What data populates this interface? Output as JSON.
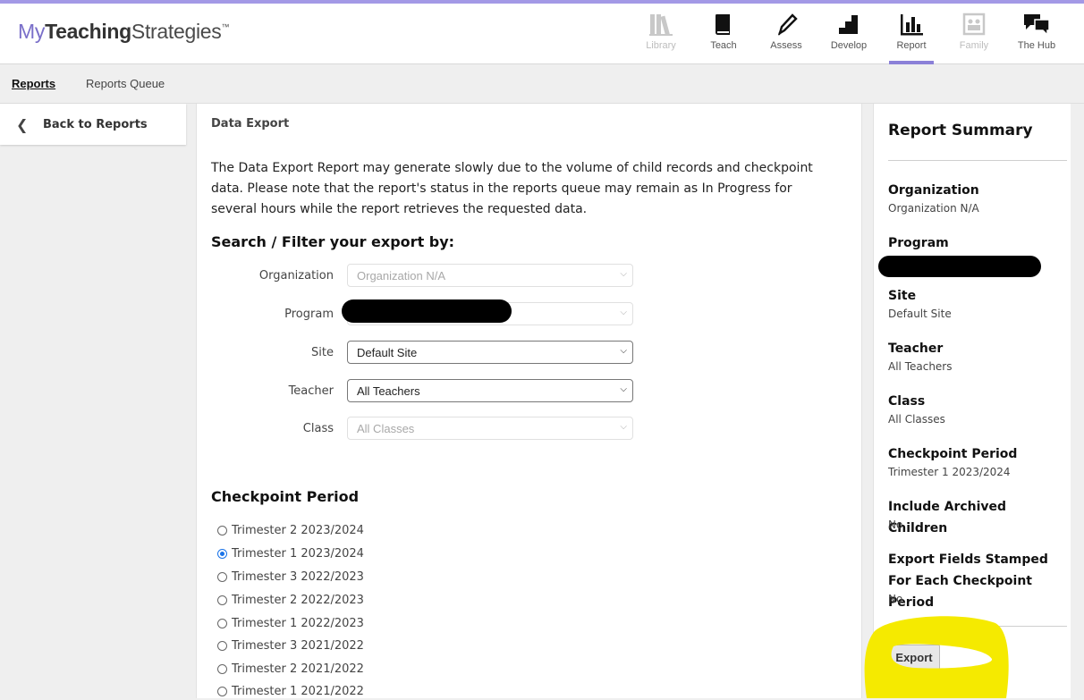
{
  "logo": {
    "my": "My",
    "teaching": "Teaching",
    "strategies": "Strategies",
    "tm": "™"
  },
  "nav": [
    {
      "label": "Library",
      "icon": "books-icon",
      "state": "disabled"
    },
    {
      "label": "Teach",
      "icon": "book-icon",
      "state": "normal"
    },
    {
      "label": "Assess",
      "icon": "pencil-icon",
      "state": "normal"
    },
    {
      "label": "Develop",
      "icon": "stairs-icon",
      "state": "normal"
    },
    {
      "label": "Report",
      "icon": "bar-chart-icon",
      "state": "active"
    },
    {
      "label": "Family",
      "icon": "family-photo-icon",
      "state": "disabled"
    },
    {
      "label": "The Hub",
      "icon": "chat-bubbles-icon",
      "state": "normal"
    }
  ],
  "subnav": {
    "reports": "Reports",
    "queue": "Reports Queue"
  },
  "back": {
    "label": "Back to Reports"
  },
  "main": {
    "title": "Data Export",
    "notice": "The Data Export Report may generate slowly due to the volume of child records and checkpoint data. Please note that the report's status in the reports queue may remain as In Progress for several hours while the report retrieves the requested data.",
    "search_heading": "Search / Filter your export by:",
    "filters": {
      "organization": {
        "label": "Organization",
        "value": "Organization N/A"
      },
      "program": {
        "label": "Program",
        "value": ""
      },
      "site": {
        "label": "Site",
        "value": "Default Site"
      },
      "teacher": {
        "label": "Teacher",
        "value": "All Teachers"
      },
      "class": {
        "label": "Class",
        "value": "All Classes"
      }
    },
    "checkpoint_heading": "Checkpoint Period",
    "checkpoints": [
      {
        "label": "Trimester 2 2023/2024",
        "checked": false
      },
      {
        "label": "Trimester 1 2023/2024",
        "checked": true
      },
      {
        "label": "Trimester 3 2022/2023",
        "checked": false
      },
      {
        "label": "Trimester 2 2022/2023",
        "checked": false
      },
      {
        "label": "Trimester 1 2022/2023",
        "checked": false
      },
      {
        "label": "Trimester 3 2021/2022",
        "checked": false
      },
      {
        "label": "Trimester 2 2021/2022",
        "checked": false
      },
      {
        "label": "Trimester 1 2021/2022",
        "checked": false
      }
    ]
  },
  "summary": {
    "title": "Report Summary",
    "organization": {
      "label": "Organization",
      "value": "Organization N/A"
    },
    "program": {
      "label": "Program",
      "value": ""
    },
    "site": {
      "label": "Site",
      "value": "Default Site"
    },
    "teacher": {
      "label": "Teacher",
      "value": "All Teachers"
    },
    "class": {
      "label": "Class",
      "value": "All Classes"
    },
    "checkpoint": {
      "label": "Checkpoint Period",
      "value": "Trimester 1 2023/2024"
    },
    "archived": {
      "label": "Include Archived Children",
      "value": "No"
    },
    "stamped": {
      "label": "Export Fields Stamped For Each Checkpoint Period",
      "value": "No"
    },
    "export_label": "Export"
  },
  "colors": {
    "accent": "#8b80d8",
    "highlight": "#f5ea00",
    "redaction": "#000000"
  }
}
